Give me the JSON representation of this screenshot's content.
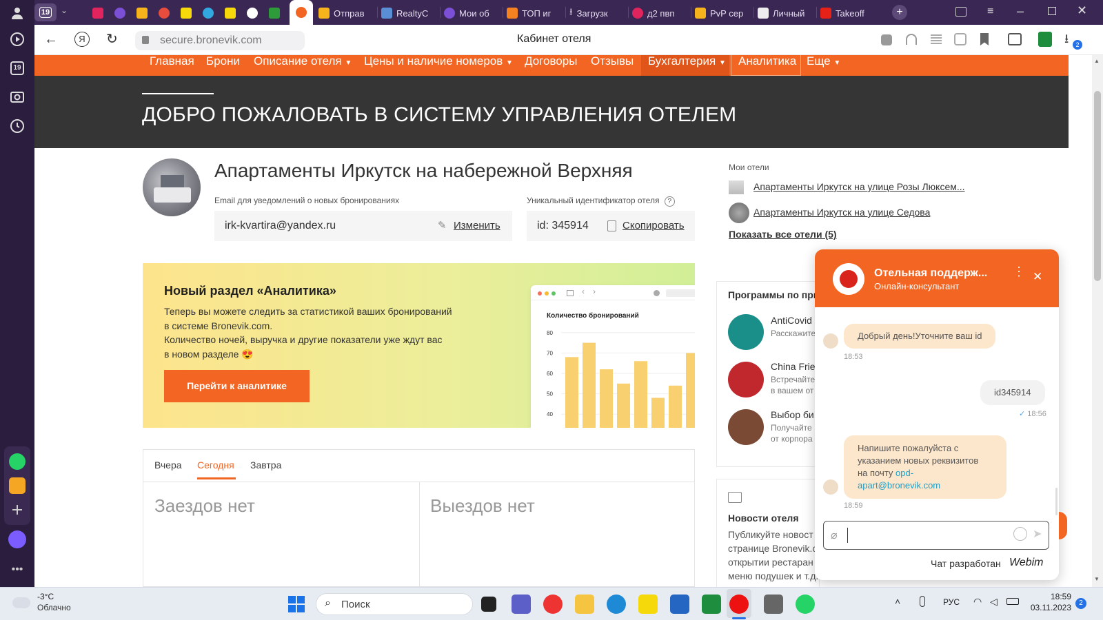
{
  "browser": {
    "tab_count_badge": "19",
    "tabs": [
      {
        "label": "Отправ"
      },
      {
        "label": "RealtyC"
      },
      {
        "label": "Мои об"
      },
      {
        "label": "ТОП иг"
      },
      {
        "label": "Загрузк"
      },
      {
        "label": "д2 пвп"
      },
      {
        "label": "PvP сер"
      },
      {
        "label": "Личный"
      },
      {
        "label": "Takeoff"
      }
    ],
    "url": "secure.bronevik.com",
    "page_title": "Кабинет отеля",
    "downloads_badge": "2",
    "sidebar_badge": "19"
  },
  "nav": {
    "items": [
      "Главная",
      "Брони",
      "Описание отеля",
      "Цены и наличие номеров",
      "Договоры",
      "Отзывы",
      "Бухгалтерия",
      "Аналитика",
      "Еще"
    ]
  },
  "hero": {
    "title": "ДОБРО ПОЖАЛОВАТЬ В СИСТЕМУ УПРАВЛЕНИЯ ОТЕЛЕМ"
  },
  "hotel": {
    "name": "Апартаменты Иркутск на набережной Верхняя",
    "email_label": "Email для уведомлений о новых бронированиях",
    "email": "irk-kvartira@yandex.ru",
    "edit_label": "Изменить",
    "id_label": "Уникальный идентификатор отеля",
    "id_value": "id: 345914",
    "copy_label": "Скопировать"
  },
  "banner": {
    "title": "Новый раздел «Аналитика»",
    "line1": "Теперь вы можете следить за статистикой ваших бронирований",
    "line2": "в системе Bronevik.com.",
    "line3": "Количество ночей, выручка и другие показатели уже ждут вас",
    "line4": "в новом разделе 😍",
    "button": "Перейти к аналитике"
  },
  "chart_data": {
    "type": "bar",
    "title": "Количество бронирований",
    "yticks": [
      80,
      70,
      60,
      50,
      40
    ],
    "ylim": [
      35,
      85
    ],
    "values": [
      68,
      75,
      62,
      55,
      66,
      48,
      54,
      70
    ],
    "color": "#f8d070"
  },
  "days": {
    "tabs": [
      "Вчера",
      "Сегодня",
      "Завтра"
    ],
    "active": "Сегодня",
    "checkins": "Заездов нет",
    "checkouts": "Выездов нет"
  },
  "my_hotels": {
    "title": "Мои отели",
    "items": [
      "Апартаменты Иркутск на улице Розы Люксем...",
      "Апартаменты Иркутск на улице Седова"
    ],
    "show_all": "Показать все отели (5)"
  },
  "programs": {
    "title": "Программы по при",
    "items": [
      {
        "name": "AntiCovid",
        "desc1": "Расскажите",
        "desc2": "",
        "color": "#1a8f8a"
      },
      {
        "name": "China Frie",
        "desc1": "Встречайте",
        "desc2": "в вашем от",
        "color": "#c0282e"
      },
      {
        "name": "Выбор би",
        "desc1": "Получайте",
        "desc2": "от корпора",
        "color": "#7a4a35"
      }
    ]
  },
  "news": {
    "title": "Новости отеля",
    "l1": "Публикуйте новост",
    "l2": "странице Bronevik.c",
    "l3": "открытии рестаран",
    "l4": "меню подушек и т.д."
  },
  "chat": {
    "title": "Отельная поддерж...",
    "subtitle": "Онлайн-консультант",
    "messages": [
      {
        "text": "Добрый день!Уточните ваш id",
        "time": "18:53"
      },
      {
        "text": "id345914",
        "time": "18:56"
      },
      {
        "l1": "Напишите пожалуйста с",
        "l2": "указанием новых реквизитов",
        "l3": "на почту",
        "link1": "opd-",
        "link2": "apart@bronevik.com",
        "time": "18:59"
      }
    ],
    "input_placeholder": "",
    "footer": "Чат разработан",
    "brand": "Webim"
  },
  "taskbar": {
    "weather_temp": "-3°C",
    "weather_desc": "Облачно",
    "search": "Поиск",
    "lang": "РУС",
    "time": "18:59",
    "date": "03.11.2023",
    "notif": "2"
  }
}
